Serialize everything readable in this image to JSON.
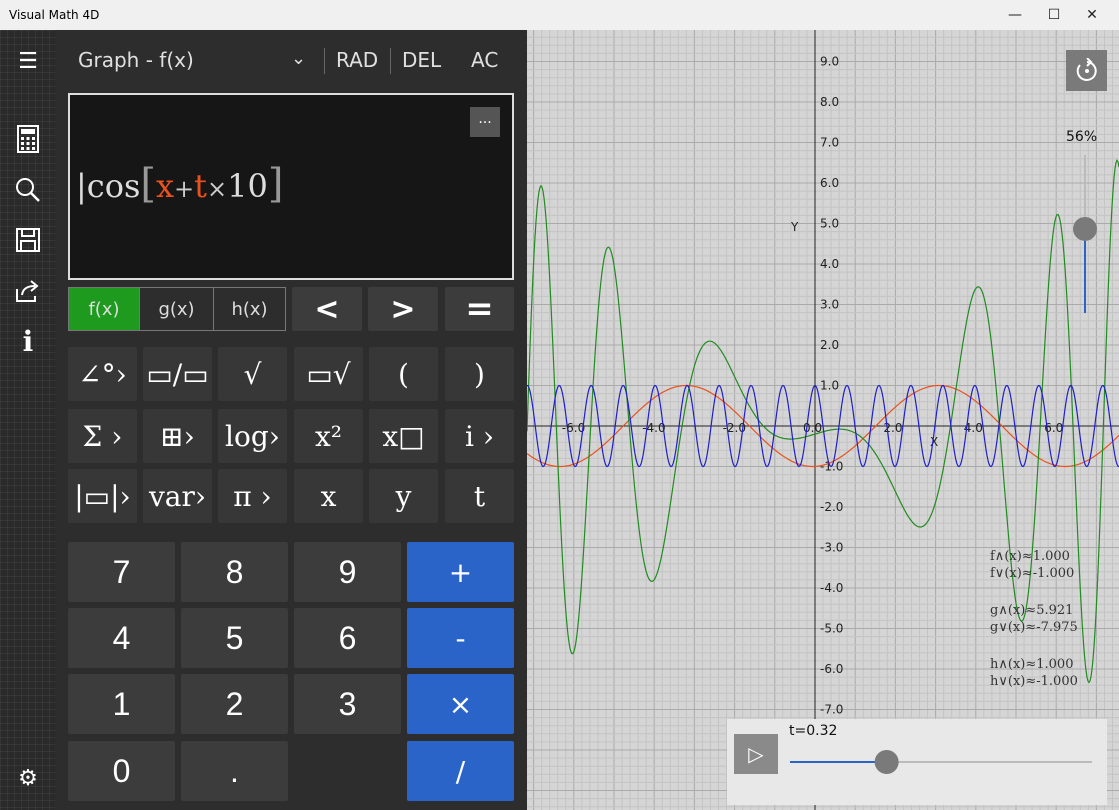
{
  "window": {
    "title": "Visual Math 4D",
    "minimize": "—",
    "maximize": "☐",
    "close": "✕"
  },
  "sidebar": {
    "menu": "☰",
    "calculator": "▦",
    "search": "⌕",
    "save": "💾",
    "share": "⇪",
    "info": "i",
    "settings": "⚙"
  },
  "header": {
    "mode_label": "Graph - f(x)",
    "dropdown": "⌄",
    "rad": "RAD",
    "del": "DEL",
    "ac": "AC"
  },
  "editor": {
    "more_label": "...",
    "cos": "cos",
    "open": "[",
    "x": "x",
    "plus": "+",
    "t": "t",
    "times": "×",
    "ten": "10",
    "close": "]"
  },
  "function_tabs": [
    "f(x)",
    "g(x)",
    "h(x)"
  ],
  "nav": {
    "left": "<",
    "right": ">",
    "equals": "="
  },
  "function_keys": [
    [
      "∠°›",
      "▭/▭",
      "√",
      "▭√",
      "(",
      ")"
    ],
    [
      "Σ ›",
      "⊞›",
      "log›",
      "x²",
      "x□",
      "i ›"
    ],
    [
      "|▭|›",
      "var›",
      "π ›",
      "x",
      "y",
      "t"
    ]
  ],
  "number_keys": [
    [
      "7",
      "8",
      "9"
    ],
    [
      "4",
      "5",
      "6"
    ],
    [
      "1",
      "2",
      "3"
    ],
    [
      "0",
      ".",
      ""
    ]
  ],
  "operator_keys": [
    "+",
    "-",
    "×",
    "/"
  ],
  "graph": {
    "x_label": "X",
    "y_label": "Y",
    "x_ticks": [
      "-6.0",
      "-4.0",
      "-2.0",
      "0.0",
      "2.0",
      "4.0",
      "6.0"
    ],
    "y_ticks": [
      "9.0",
      "8.0",
      "7.0",
      "6.0",
      "5.0",
      "4.0",
      "3.0",
      "2.0",
      "1.0",
      "-1.0",
      "-2.0",
      "-3.0",
      "-4.0",
      "-5.0",
      "-6.0",
      "-7.0"
    ],
    "zoom": "56%",
    "zoom_level": 0.56,
    "colors": {
      "f": "#e8521f",
      "g": "#228b22",
      "h": "#1f1fcc"
    },
    "extrema": {
      "f_max": "f∧(x)≈1.000",
      "f_min": "f∨(x)≈-1.000",
      "g_max": "g∧(x)≈5.921",
      "g_min": "g∨(x)≈-7.975",
      "h_max": "h∧(x)≈1.000",
      "h_min": "h∨(x)≈-1.000"
    }
  },
  "player": {
    "play": "▷",
    "t_label": "t=0.32",
    "t_value": 0.32
  }
}
